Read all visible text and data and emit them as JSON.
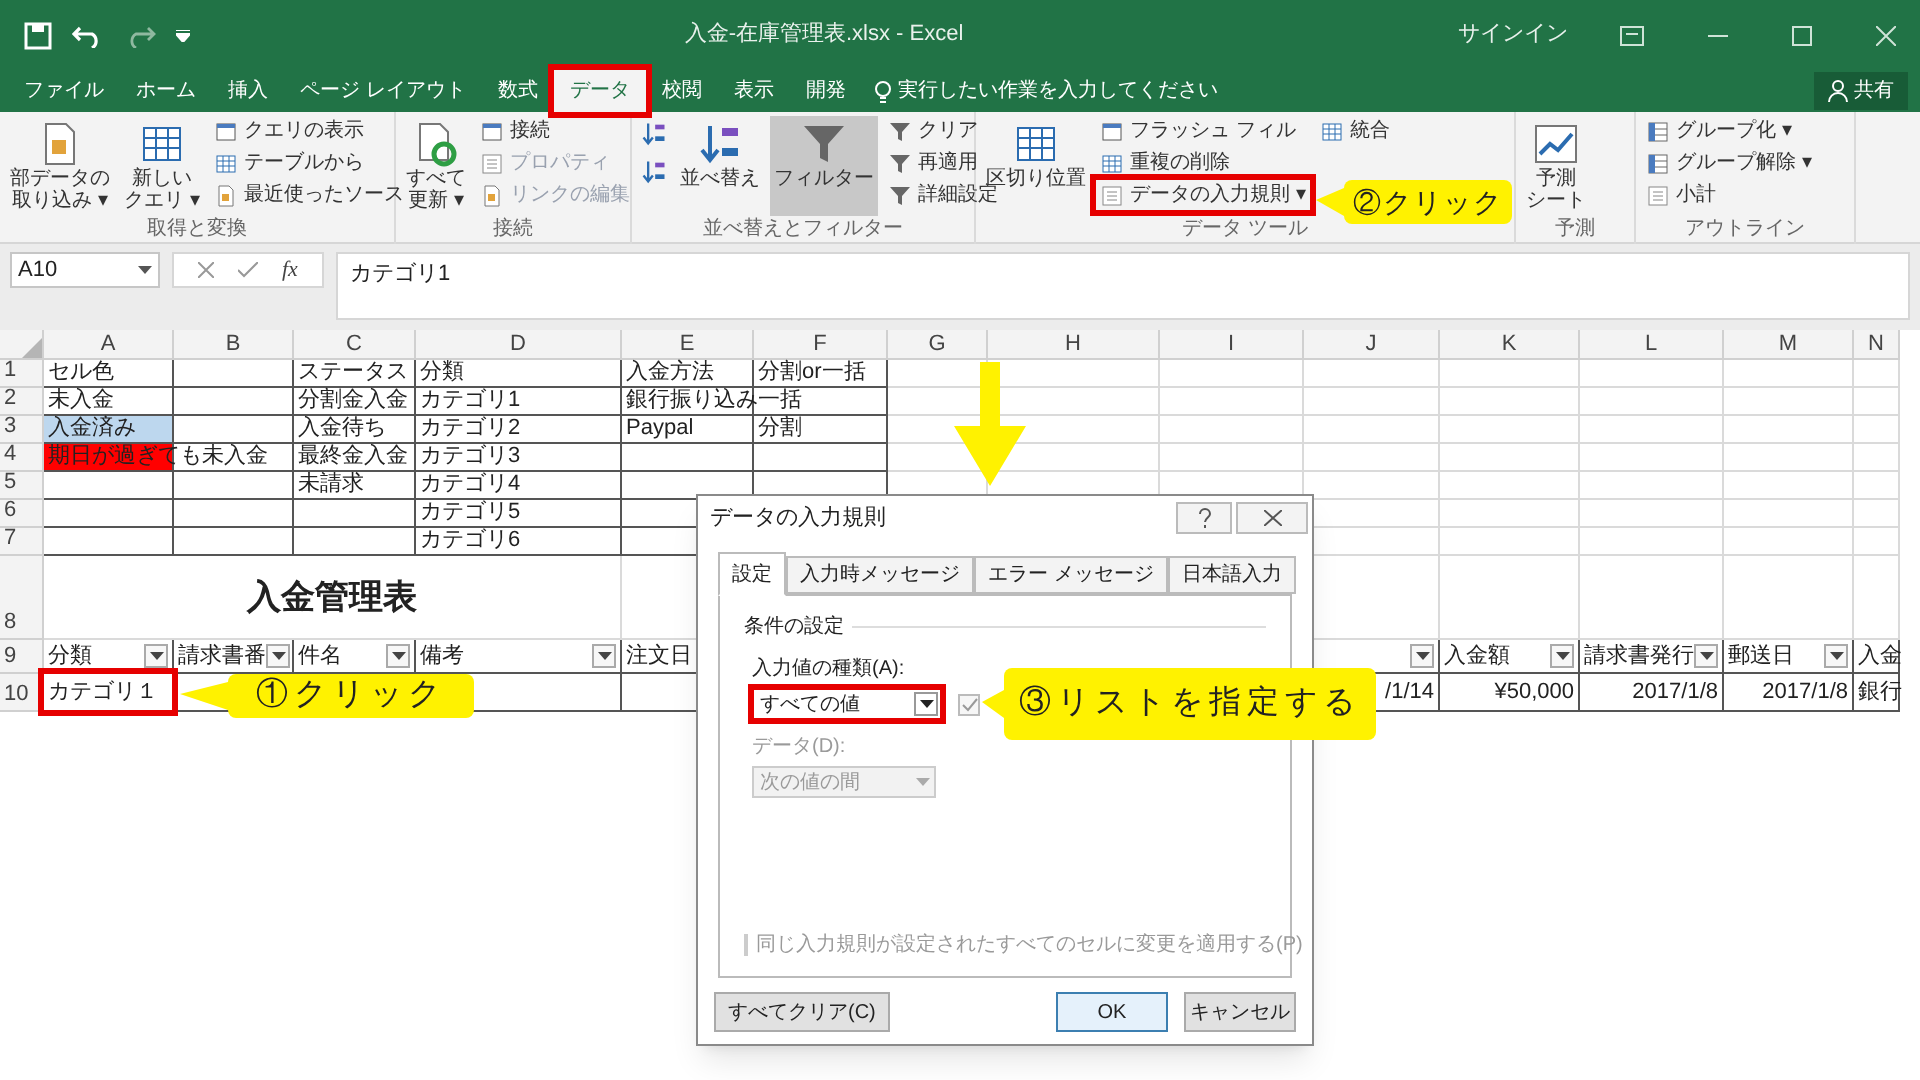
{
  "window": {
    "title": "入金-在庫管理表.xlsx - Excel",
    "sign_in": "サインイン"
  },
  "tabs": [
    {
      "label": "ファイル",
      "selected": false,
      "highlighted": false
    },
    {
      "label": "ホーム",
      "selected": false,
      "highlighted": false
    },
    {
      "label": "挿入",
      "selected": false,
      "highlighted": false
    },
    {
      "label": "ページ レイアウト",
      "selected": false,
      "highlighted": false
    },
    {
      "label": "数式",
      "selected": false,
      "highlighted": false
    },
    {
      "label": "データ",
      "selected": true,
      "highlighted": true
    },
    {
      "label": "校閲",
      "selected": false,
      "highlighted": false
    },
    {
      "label": "表示",
      "selected": false,
      "highlighted": false
    },
    {
      "label": "開発",
      "selected": false,
      "highlighted": false
    }
  ],
  "tell_me": {
    "placeholder": "実行したい作業を入力してください"
  },
  "share": "共有",
  "ribbon": {
    "groups": [
      {
        "label": "取得と変換",
        "commands": [
          {
            "kind": "large",
            "lines": [
              "部データの",
              "取り込み ▾"
            ],
            "disabled": false,
            "pressed": false,
            "highlighted": false
          },
          {
            "kind": "large",
            "lines": [
              "新しい",
              "クエリ ▾"
            ],
            "disabled": false,
            "pressed": false,
            "highlighted": false
          },
          {
            "kind": "small",
            "label": "クエリの表示",
            "disabled": false,
            "pressed": false,
            "highlighted": false
          },
          {
            "kind": "small",
            "label": "テーブルから",
            "disabled": false,
            "pressed": false,
            "highlighted": false
          },
          {
            "kind": "small",
            "label": "最近使ったソース",
            "disabled": false,
            "pressed": false,
            "highlighted": false
          }
        ]
      },
      {
        "label": "接続",
        "commands": [
          {
            "kind": "large",
            "lines": [
              "すべて",
              "更新 ▾"
            ],
            "disabled": false,
            "pressed": false,
            "highlighted": false
          },
          {
            "kind": "small",
            "label": "接続",
            "disabled": false,
            "pressed": false,
            "highlighted": false
          },
          {
            "kind": "small",
            "label": "プロパティ",
            "disabled": true,
            "pressed": false,
            "highlighted": false
          },
          {
            "kind": "small",
            "label": "リンクの編集",
            "disabled": true,
            "pressed": false,
            "highlighted": false
          }
        ]
      },
      {
        "label": "並べ替えとフィルター",
        "commands": [
          {
            "kind": "icon",
            "disabled": false,
            "pressed": false,
            "highlighted": false
          },
          {
            "kind": "icon",
            "disabled": false,
            "pressed": false,
            "highlighted": false
          },
          {
            "kind": "large",
            "lines": [
              "並べ替え"
            ],
            "disabled": false,
            "pressed": false,
            "highlighted": false
          },
          {
            "kind": "large",
            "lines": [
              "フィルター"
            ],
            "disabled": false,
            "pressed": true,
            "highlighted": false
          },
          {
            "kind": "small",
            "label": "クリア",
            "disabled": false,
            "pressed": false,
            "highlighted": false
          },
          {
            "kind": "small",
            "label": "再適用",
            "disabled": false,
            "pressed": false,
            "highlighted": false
          },
          {
            "kind": "small",
            "label": "詳細設定",
            "disabled": false,
            "pressed": false,
            "highlighted": false
          }
        ]
      },
      {
        "label": "データ ツール",
        "commands": [
          {
            "kind": "large",
            "lines": [
              "区切り位置"
            ],
            "disabled": false,
            "pressed": false,
            "highlighted": false
          },
          {
            "kind": "small",
            "label": "フラッシュ フィル",
            "disabled": false,
            "pressed": false,
            "highlighted": false
          },
          {
            "kind": "small",
            "label": "重複の削除",
            "disabled": false,
            "pressed": false,
            "highlighted": false
          },
          {
            "kind": "small",
            "label": "データの入力規則 ▾",
            "disabled": false,
            "pressed": false,
            "highlighted": true
          },
          {
            "kind": "small",
            "label": "統合",
            "disabled": false,
            "pressed": false,
            "highlighted": false
          }
        ]
      },
      {
        "label": "予測",
        "commands": [
          {
            "kind": "large",
            "lines": [
              "予測",
              "シート"
            ],
            "disabled": false,
            "pressed": false,
            "highlighted": false
          }
        ]
      },
      {
        "label": "アウトライン",
        "commands": [
          {
            "kind": "small",
            "label": "グループ化 ▾",
            "disabled": false,
            "pressed": false,
            "highlighted": false
          },
          {
            "kind": "small",
            "label": "グループ解除 ▾",
            "disabled": false,
            "pressed": false,
            "highlighted": false
          },
          {
            "kind": "small",
            "label": "小計",
            "disabled": false,
            "pressed": false,
            "highlighted": false
          }
        ]
      }
    ]
  },
  "formula_bar": {
    "name_box": "A10",
    "function_label": "fx",
    "formula": "カテゴリ1"
  },
  "sheet": {
    "columns": [
      "A",
      "B",
      "C",
      "D",
      "E",
      "F",
      "G",
      "H",
      "I",
      "J",
      "K",
      "L",
      "M",
      "N"
    ],
    "rows": [
      {
        "header": "1",
        "cells": [
          {
            "kind": "text",
            "text": "セル色"
          },
          {
            "kind": "empty"
          },
          {
            "kind": "text",
            "text": "ステータス"
          },
          {
            "kind": "text",
            "text": "分類"
          },
          {
            "kind": "text",
            "text": "入金方法"
          },
          {
            "kind": "text",
            "text": "分割or一括"
          }
        ]
      },
      {
        "header": "2",
        "cells": [
          {
            "kind": "text",
            "text": "未入金"
          },
          {
            "kind": "empty"
          },
          {
            "kind": "text",
            "text": "分割金入金"
          },
          {
            "kind": "text",
            "text": "カテゴリ1"
          },
          {
            "kind": "text",
            "text": "銀行振り込み"
          },
          {
            "kind": "text",
            "text": "一括"
          }
        ]
      },
      {
        "header": "3",
        "cells": [
          {
            "kind": "text",
            "text": "入金済み",
            "color": "#bdd7ee"
          },
          {
            "kind": "empty"
          },
          {
            "kind": "text",
            "text": "入金待ち"
          },
          {
            "kind": "text",
            "text": "カテゴリ2"
          },
          {
            "kind": "text",
            "text": "Paypal"
          },
          {
            "kind": "text",
            "text": "分割"
          }
        ]
      },
      {
        "header": "4",
        "cells": [
          {
            "kind": "text",
            "text": "期日が過ぎても未入金",
            "color": "#ff0000"
          },
          {
            "kind": "empty"
          },
          {
            "kind": "text",
            "text": "最終金入金"
          },
          {
            "kind": "text",
            "text": "カテゴリ3"
          }
        ]
      },
      {
        "header": "5",
        "cells": [
          {
            "kind": "empty"
          },
          {
            "kind": "empty"
          },
          {
            "kind": "text",
            "text": "未請求"
          },
          {
            "kind": "text",
            "text": "カテゴリ4"
          }
        ]
      },
      {
        "header": "6",
        "cells": [
          {
            "kind": "empty"
          },
          {
            "kind": "empty"
          },
          {
            "kind": "empty"
          },
          {
            "kind": "text",
            "text": "カテゴリ5"
          }
        ]
      },
      {
        "header": "7",
        "cells": [
          {
            "kind": "empty"
          },
          {
            "kind": "empty"
          },
          {
            "kind": "empty"
          },
          {
            "kind": "text",
            "text": "カテゴリ6"
          }
        ]
      },
      {
        "header": "8",
        "cells": [
          {
            "kind": "title",
            "text": "入金管理表"
          }
        ]
      },
      {
        "header": "9",
        "cells": [
          {
            "kind": "filter_header",
            "text": "分類"
          },
          {
            "kind": "filter_header",
            "text": "請求書番"
          },
          {
            "kind": "filter_header",
            "text": "件名"
          },
          {
            "kind": "filter_header",
            "text": "備考"
          },
          {
            "kind": "text",
            "text": "注文日"
          },
          {
            "kind": "empty"
          },
          {
            "kind": "empty"
          },
          {
            "kind": "empty"
          },
          {
            "kind": "empty"
          },
          {
            "kind": "filter_only"
          },
          {
            "kind": "filter_header",
            "text": "入金額"
          },
          {
            "kind": "filter_header",
            "text": "請求書発行"
          },
          {
            "kind": "filter_header",
            "text": "郵送日"
          },
          {
            "kind": "text",
            "text": "入金"
          }
        ]
      },
      {
        "header": "10",
        "cells": [
          {
            "kind": "text",
            "text": "カテゴリ１",
            "highlighted": true
          },
          {
            "kind": "empty"
          },
          {
            "kind": "empty"
          },
          {
            "kind": "empty"
          },
          {
            "kind": "empty"
          },
          {
            "kind": "empty"
          },
          {
            "kind": "empty"
          },
          {
            "kind": "empty"
          },
          {
            "kind": "empty"
          },
          {
            "kind": "number",
            "text": "/1/14"
          },
          {
            "kind": "number",
            "text": "¥50,000"
          },
          {
            "kind": "number",
            "text": "2017/1/8"
          },
          {
            "kind": "number",
            "text": "2017/1/8"
          },
          {
            "kind": "text",
            "text": "銀行"
          }
        ]
      }
    ]
  },
  "dialog": {
    "title": "データの入力規則",
    "tabs": [
      {
        "label": "設定",
        "selected": true
      },
      {
        "label": "入力時メッセージ",
        "selected": false
      },
      {
        "label": "エラー メッセージ",
        "selected": false
      },
      {
        "label": "日本語入力",
        "selected": false
      }
    ],
    "section": "条件の設定",
    "allow_label": "入力値の種類(A):",
    "allow": {
      "value": "すべての値",
      "highlighted": true
    },
    "ignore_blank": {
      "checked": true
    },
    "data_label": "データ(D):",
    "data": {
      "value": "次の値の間",
      "disabled": true
    },
    "apply_all": {
      "label": "同じ入力規則が設定されたすべてのセルに変更を適用する(P)",
      "checked": false,
      "disabled": true
    },
    "buttons": [
      {
        "kind": "clear",
        "label": "すべてクリア(C)"
      },
      {
        "kind": "default",
        "label": "OK"
      },
      {
        "kind": "normal",
        "label": "キャンセル"
      }
    ]
  },
  "callouts": [
    {
      "kind": "ribbon",
      "text": "②クリック"
    },
    {
      "kind": "cell",
      "text": "①クリック"
    },
    {
      "kind": "dropdown",
      "text": "③リストを指定する"
    }
  ]
}
